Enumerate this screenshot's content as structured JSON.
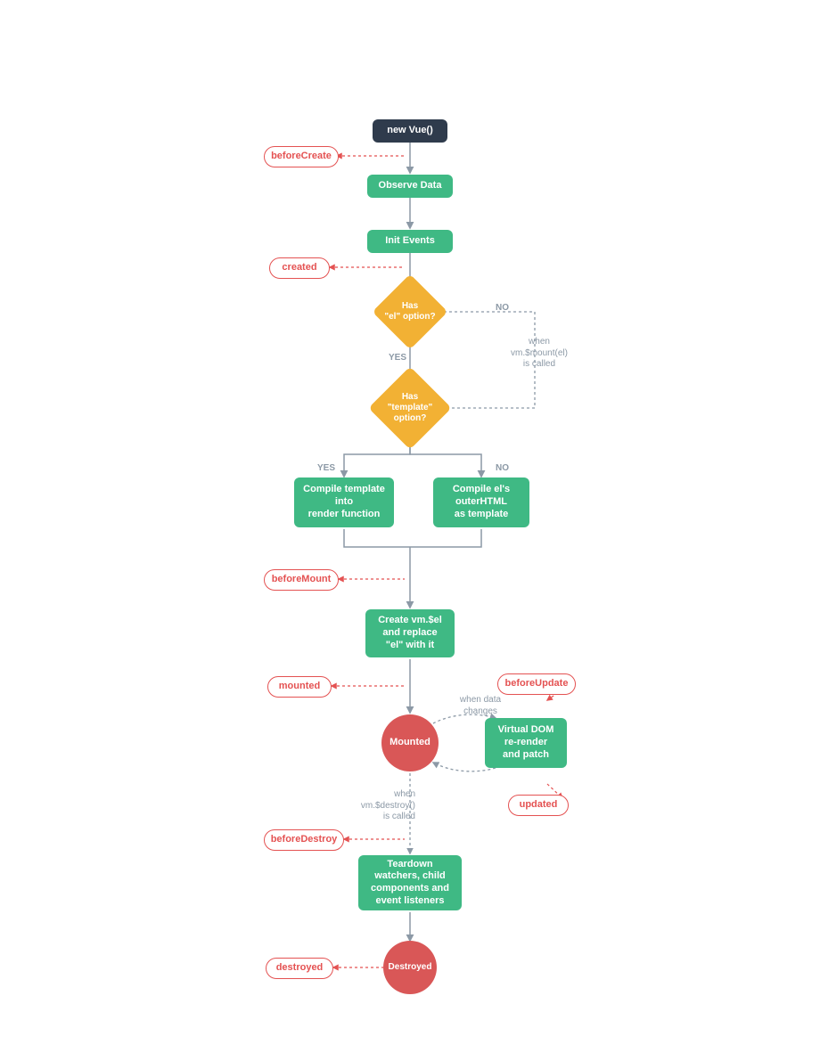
{
  "nodes": {
    "new_vue": "new Vue()",
    "observe_data": "Observe Data",
    "init_events": "Init Events",
    "has_el": "Has\n\"el\" option?",
    "has_template": "Has\n\"template\"\noption?",
    "compile_template": "Compile template\ninto\nrender function",
    "compile_el": "Compile el's\nouterHTML\nas template",
    "create_vm_el": "Create vm.$el\nand replace\n\"el\" with it",
    "mounted_state": "Mounted",
    "virtual_dom": "Virtual DOM\nre-render\nand patch",
    "teardown": "Teardown\nwatchers, child\ncomponents and\nevent listeners",
    "destroyed_state": "Destroyed"
  },
  "hooks": {
    "before_create": "beforeCreate",
    "created": "created",
    "before_mount": "beforeMount",
    "mounted": "mounted",
    "before_update": "beforeUpdate",
    "updated": "updated",
    "before_destroy": "beforeDestroy",
    "destroyed": "destroyed"
  },
  "labels": {
    "yes": "YES",
    "no": "NO",
    "when_mount": "when\nvm.$mount(el)\nis called",
    "when_data": "when data\nchanges",
    "when_destroy": "when\nvm.$destroy()\nis called"
  },
  "colors": {
    "dark": "#2F3B4C",
    "green": "#3FB984",
    "amber": "#F2B134",
    "red": "#D95757",
    "hook": "#E45252",
    "line_solid": "#8C99A6",
    "line_dash": "#8C99A6",
    "line_red": "#E45252"
  }
}
